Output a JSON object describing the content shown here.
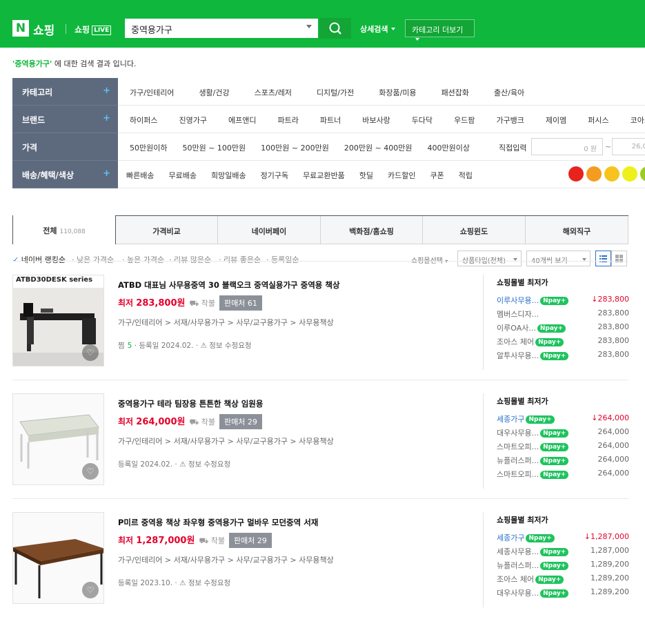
{
  "header": {
    "logo_n": "N",
    "logo_text": "쇼핑",
    "live_text": "쇼핑",
    "live_badge": "LIVE",
    "search_value": "중역용가구",
    "detail_search": "상세검색",
    "category_more": "카테고리 더보기"
  },
  "result_text": {
    "keyword": "'중역용가구'",
    "suffix": " 에 대한 검색 결과 입니다."
  },
  "filters": {
    "category": {
      "label": "카테고리",
      "items": [
        "가구/인테리어",
        "생활/건강",
        "스포츠/레저",
        "디지털/가전",
        "화장품/미용",
        "패션잡화",
        "출산/육아"
      ]
    },
    "brand": {
      "label": "브랜드",
      "items": [
        "하이퍼스",
        "진영가구",
        "에프앤디",
        "파트라",
        "파트너",
        "바보사랑",
        "두다닥",
        "우드팜",
        "가구뱅크",
        "제이엠",
        "퍼시스",
        "코아스"
      ]
    },
    "price": {
      "label": "가격",
      "items": [
        "50만원이하",
        "50만원 ~ 100만원",
        "100만원 ~ 200만원",
        "200만원 ~ 400만원",
        "400만원이상"
      ],
      "direct": "직접입력",
      "min_placeholder": "0 원",
      "tilde": "~",
      "max_placeholder": "26,0"
    },
    "delivery": {
      "label": "배송/혜택/색상",
      "items": [
        "빠른배송",
        "무료배송",
        "희망일배송",
        "정기구독",
        "무료교환반품",
        "핫딜",
        "카드할인",
        "쿠폰",
        "적립"
      ],
      "colors": [
        "#e8231e",
        "#f39c1f",
        "#f6c41c",
        "#eef01a",
        "#9acd1e"
      ]
    }
  },
  "tabs": [
    {
      "label": "전체",
      "count": "110,088"
    },
    {
      "label": "가격비교"
    },
    {
      "label": "네이버페이"
    },
    {
      "label": "백화점/홈쇼핑"
    },
    {
      "label": "쇼핑윈도"
    },
    {
      "label": "해외직구"
    }
  ],
  "sort": {
    "active": "네이버 랭킹순",
    "options": [
      "낮은 가격순",
      "높은 가격순",
      "리뷰 많은순",
      "리뷰 좋은순",
      "등록일순"
    ],
    "mall_select": "쇼핑몰선택",
    "product_type": "상품타입(전체)",
    "view_count": "40개씩 보기"
  },
  "products": [
    {
      "title": "ATBD 대표님 사무용중역 30 블랙오크 중역실용가구 중역용 책상",
      "min_label": "최저",
      "price": "283,800원",
      "delivery": "착불",
      "sellers": "판매처 61",
      "category": "가구/인테리어 > 서재/사무용가구 > 사무/교구용가구 > 사무용책상",
      "zzim_label": "찜",
      "zzim_count": "5",
      "reg_date": "등록일 2024.02.",
      "report": "정보 수정요청",
      "thumb_caption": "ATBD30DESK series",
      "mall_header": "쇼핑몰별 최저가",
      "malls": [
        {
          "name": "이루사무용...",
          "npay": true,
          "price": "283,800",
          "low": true
        },
        {
          "name": "멤버스디자...",
          "npay": false,
          "price": "283,800",
          "low": false
        },
        {
          "name": "이루OA사...",
          "npay": true,
          "price": "283,800",
          "low": false
        },
        {
          "name": "조아스 체어",
          "npay": true,
          "price": "283,800",
          "low": false
        },
        {
          "name": "알투사무용...",
          "npay": true,
          "price": "283,800",
          "low": false
        }
      ]
    },
    {
      "title": "중역용가구 테라 팀장용 튼튼한 책상 임원용",
      "min_label": "최저",
      "price": "264,000원",
      "delivery": "착불",
      "sellers": "판매처 29",
      "category": "가구/인테리어 > 서재/사무용가구 > 사무/교구용가구 > 사무용책상",
      "reg_date": "등록일 2024.02.",
      "report": "정보 수정요청",
      "mall_header": "쇼핑몰별 최저가",
      "malls": [
        {
          "name": "세종가구",
          "npay": true,
          "price": "264,000",
          "low": true
        },
        {
          "name": "대우사무용...",
          "npay": true,
          "price": "264,000",
          "low": false
        },
        {
          "name": "스마트오피...",
          "npay": true,
          "price": "264,000",
          "low": false
        },
        {
          "name": "뉴플러스퍼...",
          "npay": true,
          "price": "264,000",
          "low": false
        },
        {
          "name": "스마트오피...",
          "npay": true,
          "price": "264,000",
          "low": false
        }
      ]
    },
    {
      "title": "P미르 중역용 책상 좌우형 중역용가구 멀바우 모던중역 서재",
      "min_label": "최저",
      "price": "1,287,000원",
      "delivery": "착불",
      "sellers": "판매처 29",
      "category": "가구/인테리어 > 서재/사무용가구 > 사무/교구용가구 > 사무용책상",
      "reg_date": "등록일 2023.10.",
      "report": "정보 수정요청",
      "mall_header": "쇼핑몰별 최저가",
      "malls": [
        {
          "name": "세종가구",
          "npay": true,
          "price": "1,287,000",
          "low": true
        },
        {
          "name": "세종사무용...",
          "npay": true,
          "price": "1,287,000",
          "low": false
        },
        {
          "name": "뉴플러스퍼...",
          "npay": true,
          "price": "1,289,200",
          "low": false
        },
        {
          "name": "조아스 체어",
          "npay": true,
          "price": "1,289,200",
          "low": false
        },
        {
          "name": "대우사무용...",
          "npay": true,
          "price": "1,289,200",
          "low": false
        }
      ]
    }
  ],
  "npay_label": "pay"
}
